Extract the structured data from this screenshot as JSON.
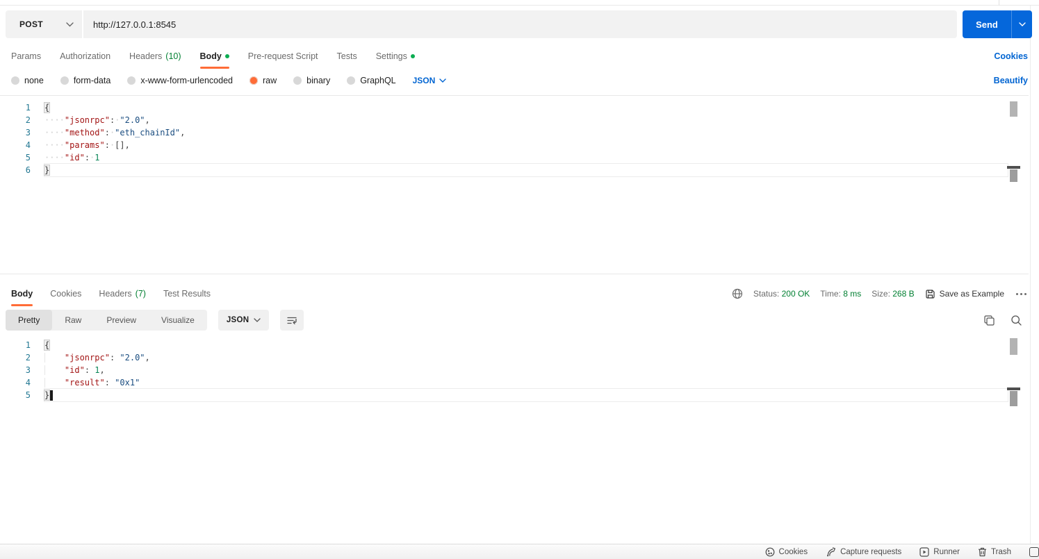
{
  "colors": {
    "accent_orange": "#ff6c37",
    "primary_blue": "#0265d2",
    "success_green": "#007f31",
    "dot_green": "#0cad52"
  },
  "request_bar": {
    "method": "POST",
    "url": "http://127.0.0.1:8545",
    "send_label": "Send"
  },
  "request_tabs": {
    "params": "Params",
    "authorization": "Authorization",
    "headers": "Headers",
    "headers_count": "(10)",
    "body": "Body",
    "prerequest": "Pre-request Script",
    "tests": "Tests",
    "settings": "Settings",
    "cookies_link": "Cookies"
  },
  "body_type_row": {
    "none": "none",
    "form_data": "form-data",
    "urlencoded": "x-www-form-urlencoded",
    "raw": "raw",
    "binary": "binary",
    "graphql": "GraphQL",
    "language": "JSON",
    "beautify_link": "Beautify"
  },
  "request_editor": {
    "lines": [
      {
        "n": 1,
        "tokens": [
          {
            "t": "{",
            "c": "brace"
          }
        ]
      },
      {
        "n": 2,
        "tokens": [
          {
            "t": "····",
            "c": "ws"
          },
          {
            "t": "\"jsonrpc\"",
            "c": "key"
          },
          {
            "t": ":",
            "c": "pun"
          },
          {
            "t": "·",
            "c": "ws"
          },
          {
            "t": "\"2.0\"",
            "c": "str"
          },
          {
            "t": ",",
            "c": "pun"
          }
        ]
      },
      {
        "n": 3,
        "tokens": [
          {
            "t": "····",
            "c": "ws"
          },
          {
            "t": "\"method\"",
            "c": "key"
          },
          {
            "t": ":",
            "c": "pun"
          },
          {
            "t": "·",
            "c": "ws"
          },
          {
            "t": "\"eth_chainId\"",
            "c": "str"
          },
          {
            "t": ",",
            "c": "pun"
          }
        ]
      },
      {
        "n": 4,
        "tokens": [
          {
            "t": "····",
            "c": "ws"
          },
          {
            "t": "\"params\"",
            "c": "key"
          },
          {
            "t": ":",
            "c": "pun"
          },
          {
            "t": "·",
            "c": "ws"
          },
          {
            "t": "[]",
            "c": "pun"
          },
          {
            "t": ",",
            "c": "pun"
          }
        ]
      },
      {
        "n": 5,
        "tokens": [
          {
            "t": "····",
            "c": "ws"
          },
          {
            "t": "\"id\"",
            "c": "key"
          },
          {
            "t": ":",
            "c": "pun"
          },
          {
            "t": "·",
            "c": "ws"
          },
          {
            "t": "1",
            "c": "num"
          }
        ]
      },
      {
        "n": 6,
        "cur": true,
        "tokens": [
          {
            "t": "}",
            "c": "brace"
          }
        ]
      }
    ]
  },
  "response_header": {
    "body": "Body",
    "cookies": "Cookies",
    "headers": "Headers",
    "headers_count": "(7)",
    "test_results": "Test Results",
    "status_label": "Status:",
    "status_value": "200 OK",
    "time_label": "Time:",
    "time_value": "8 ms",
    "size_label": "Size:",
    "size_value": "268 B",
    "save_as_example": "Save as Example"
  },
  "response_toolbar": {
    "pretty": "Pretty",
    "raw": "Raw",
    "preview": "Preview",
    "visualize": "Visualize",
    "language": "JSON"
  },
  "response_editor": {
    "lines": [
      {
        "n": 1,
        "tokens": [
          {
            "t": "{",
            "c": "brace"
          }
        ]
      },
      {
        "n": 2,
        "tokens": [
          {
            "t": "    ",
            "c": "guide"
          },
          {
            "t": "\"jsonrpc\"",
            "c": "key"
          },
          {
            "t": ":",
            "c": "pun"
          },
          {
            "t": " ",
            "c": "ws"
          },
          {
            "t": "\"2.0\"",
            "c": "str"
          },
          {
            "t": ",",
            "c": "pun"
          }
        ]
      },
      {
        "n": 3,
        "tokens": [
          {
            "t": "    ",
            "c": "guide"
          },
          {
            "t": "\"id\"",
            "c": "key"
          },
          {
            "t": ":",
            "c": "pun"
          },
          {
            "t": " ",
            "c": "ws"
          },
          {
            "t": "1",
            "c": "num"
          },
          {
            "t": ",",
            "c": "pun"
          }
        ]
      },
      {
        "n": 4,
        "tokens": [
          {
            "t": "    ",
            "c": "guide"
          },
          {
            "t": "\"result\"",
            "c": "key"
          },
          {
            "t": ":",
            "c": "pun"
          },
          {
            "t": " ",
            "c": "ws"
          },
          {
            "t": "\"0x1\"",
            "c": "str"
          }
        ]
      },
      {
        "n": 5,
        "cur": true,
        "cursor": true,
        "tokens": [
          {
            "t": "}",
            "c": "brace"
          }
        ]
      }
    ]
  },
  "status_bar": {
    "cookies": "Cookies",
    "capture": "Capture requests",
    "runner": "Runner",
    "trash": "Trash"
  }
}
